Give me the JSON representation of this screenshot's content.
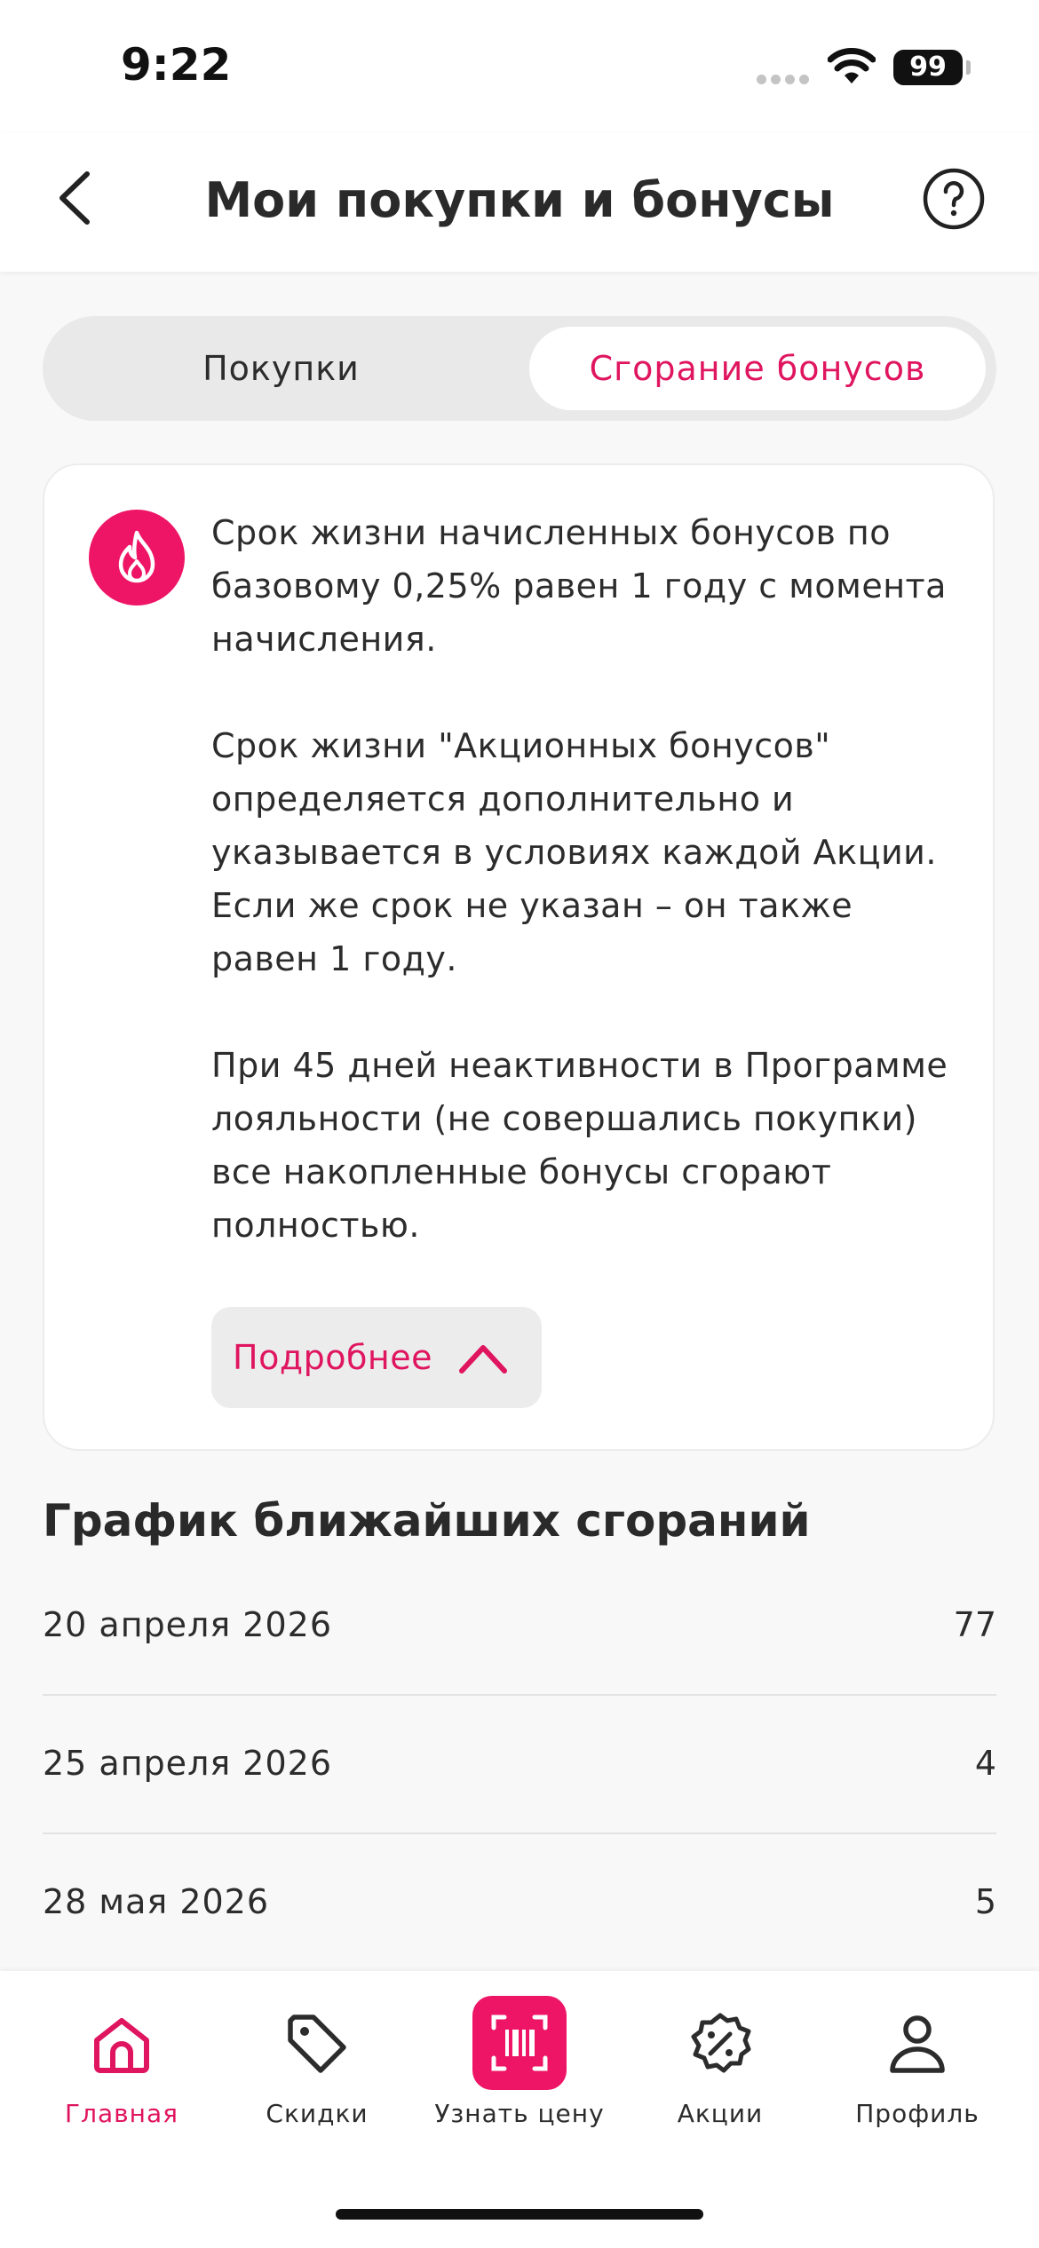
{
  "status_bar": {
    "time": "9:22",
    "battery": "99"
  },
  "header": {
    "title": "Мои покупки и бонусы"
  },
  "segment": {
    "left_label": "Покупки",
    "right_label": "Сгорание бонусов",
    "selected": "right"
  },
  "info_card": {
    "paragraphs": [
      "Срок жизни начисленных бонусов по базовому 0,25% равен 1 году с момента начисления.",
      "Срок жизни \"Акционных бонусов\" определяется дополнительно и указывается в условиях каждой Акции. Если же срок не указан – он также равен 1 году.",
      "При 45 дней неактивности в Программе лояльности (не совершались покупки) все накопленные бонусы сгорают полностью."
    ],
    "more_label": "Подробнее"
  },
  "schedule": {
    "title": "График ближайших сгораний",
    "rows": [
      {
        "date": "20 апреля 2026",
        "amount": "77"
      },
      {
        "date": "25 апреля 2026",
        "amount": "4"
      },
      {
        "date": "28 мая 2026",
        "amount": "5"
      }
    ]
  },
  "tabbar": {
    "items": [
      {
        "label": "Главная",
        "icon": "home-icon",
        "active": true
      },
      {
        "label": "Скидки",
        "icon": "tag-icon",
        "active": false
      },
      {
        "label": "Узнать цену",
        "icon": "barcode-icon",
        "active": false
      },
      {
        "label": "Акции",
        "icon": "percent-badge-icon",
        "active": false
      },
      {
        "label": "Профиль",
        "icon": "person-icon",
        "active": false
      }
    ]
  },
  "colors": {
    "accent": "#ee1566",
    "text": "#2c2c2c",
    "background": "#f8f8f8"
  }
}
